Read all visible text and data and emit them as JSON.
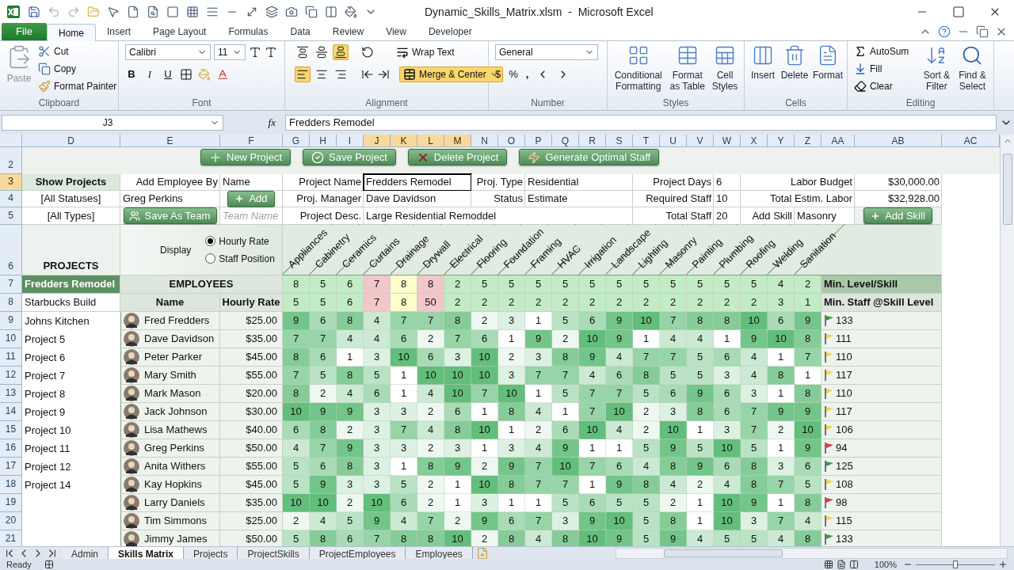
{
  "window": {
    "title": "Dynamic_Skills_Matrix.xlsm  -  Microsoft Excel"
  },
  "ribbon_tabs": [
    {
      "label": "File",
      "kind": "file",
      "selected": false
    },
    {
      "label": "Home",
      "kind": "tab",
      "selected": true
    },
    {
      "label": "Insert",
      "kind": "tab",
      "selected": false
    },
    {
      "label": "Page Layout",
      "kind": "tab",
      "selected": false
    },
    {
      "label": "Formulas",
      "kind": "tab",
      "selected": false
    },
    {
      "label": "Data",
      "kind": "tab",
      "selected": false
    },
    {
      "label": "Review",
      "kind": "tab",
      "selected": false
    },
    {
      "label": "View",
      "kind": "tab",
      "selected": false
    },
    {
      "label": "Developer",
      "kind": "tab",
      "selected": false
    }
  ],
  "ribbon": {
    "clipboard": {
      "label": "Clipboard",
      "paste": "Paste",
      "cut": "Cut",
      "copy": "Copy",
      "format_painter": "Format Painter"
    },
    "font": {
      "label": "Font",
      "family": "Calibri",
      "size": "11",
      "bold": "B",
      "italic": "I",
      "underline": "U"
    },
    "alignment": {
      "label": "Alignment",
      "vertical": [
        {
          "selected": false
        },
        {
          "selected": false
        },
        {
          "selected": true
        }
      ],
      "horizontal": [
        {
          "selected": true
        },
        {
          "selected": false
        },
        {
          "selected": false
        }
      ],
      "wrap_text": "Wrap Text",
      "merge_center": "Merge & Center",
      "merge_on": true
    },
    "number": {
      "label": "Number",
      "format": "General",
      "currency": "$",
      "percent": "%",
      "comma": ","
    },
    "styles": {
      "label": "Styles",
      "buttons": [
        "Conditional Formatting",
        "Format as Table",
        "Cell Styles"
      ]
    },
    "cells": {
      "label": "Cells",
      "buttons": [
        "Insert",
        "Delete",
        "Format"
      ]
    },
    "editing": {
      "label": "Editing",
      "autosum": "AutoSum",
      "fill": "Fill",
      "clear": "Clear",
      "sort_filter": "Sort & Filter",
      "find_select": "Find & Select"
    }
  },
  "formula_bar": {
    "name_box": "J3",
    "fx": "fx",
    "value": "Fredders Remodel"
  },
  "columns": [
    {
      "label": "D",
      "selected": false
    },
    {
      "label": "E",
      "selected": false
    },
    {
      "label": "F",
      "selected": false
    },
    {
      "label": "G",
      "selected": false
    },
    {
      "label": "H",
      "selected": false
    },
    {
      "label": "I",
      "selected": false
    },
    {
      "label": "J",
      "selected": true
    },
    {
      "label": "K",
      "selected": true
    },
    {
      "label": "L",
      "selected": true
    },
    {
      "label": "M",
      "selected": true
    },
    {
      "label": "N",
      "selected": false
    },
    {
      "label": "O",
      "selected": false
    },
    {
      "label": "P",
      "selected": false
    },
    {
      "label": "Q",
      "selected": false
    },
    {
      "label": "R",
      "selected": false
    },
    {
      "label": "S",
      "selected": false
    },
    {
      "label": "T",
      "selected": false
    },
    {
      "label": "U",
      "selected": false
    },
    {
      "label": "V",
      "selected": false
    },
    {
      "label": "W",
      "selected": false
    },
    {
      "label": "X",
      "selected": false
    },
    {
      "label": "Y",
      "selected": false
    },
    {
      "label": "Z",
      "selected": false
    },
    {
      "label": "AA",
      "selected": false
    },
    {
      "label": "AB",
      "selected": false
    },
    {
      "label": "AC",
      "selected": false
    }
  ],
  "row_numbers": [
    {
      "label": "2",
      "selected": false
    },
    {
      "label": "3",
      "selected": true
    },
    {
      "label": "4",
      "selected": false
    },
    {
      "label": "5",
      "selected": false
    },
    {
      "label": "6",
      "selected": false
    },
    {
      "label": "7",
      "selected": false
    },
    {
      "label": "8",
      "selected": false
    },
    {
      "label": "9",
      "selected": false
    },
    {
      "label": "10",
      "selected": false
    },
    {
      "label": "11",
      "selected": false
    },
    {
      "label": "12",
      "selected": false
    },
    {
      "label": "13",
      "selected": false
    },
    {
      "label": "14",
      "selected": false
    },
    {
      "label": "15",
      "selected": false
    },
    {
      "label": "16",
      "selected": false
    },
    {
      "label": "17",
      "selected": false
    },
    {
      "label": "18",
      "selected": false
    },
    {
      "label": "19",
      "selected": false
    },
    {
      "label": "20",
      "selected": false
    },
    {
      "label": "21",
      "selected": false
    }
  ],
  "sheet": {
    "buttons": [
      {
        "label": "New Project",
        "kind": "new"
      },
      {
        "label": "Save Project",
        "kind": "save"
      },
      {
        "label": "Delete Project",
        "kind": "delete"
      },
      {
        "label": "Generate Optimal Staff",
        "kind": "generate"
      }
    ],
    "filter": {
      "title": "Show Projects",
      "status": "[All Statuses]",
      "type": "[All Types]",
      "projects_header": "PROJECTS"
    },
    "add_employee": {
      "label": "Add Employee By",
      "by": "Name",
      "employee": "Greg Perkins",
      "add_button": "Add",
      "team_button": "Save As Team",
      "team_placeholder": "Team Name"
    },
    "project_fields": [
      {
        "label": "Project Name",
        "value": "Fredders Remodel",
        "selected": true
      },
      {
        "label": "Proj. Manager",
        "value": "Dave Davidson",
        "selected": false
      },
      {
        "label": "Project Desc.",
        "value": "Large Residential Remoddel",
        "selected": false
      }
    ],
    "details": [
      {
        "label": "Proj. Type",
        "value": "Residential"
      },
      {
        "label": "Status",
        "value": "Estimate"
      }
    ],
    "staffing": [
      {
        "label": "Project Days",
        "value": "6"
      },
      {
        "label": "Required Staff",
        "value": "10"
      },
      {
        "label": "Total Staff",
        "value": "20"
      }
    ],
    "labor": [
      {
        "label": "Labor Budget",
        "value": "$30,000.00"
      },
      {
        "label": "Total Estim. Labor",
        "value": "$32,928.00"
      }
    ],
    "add_skill": {
      "label": "Add Skill",
      "value": "Masonry",
      "button": "Add Skill"
    },
    "display": {
      "label": "Display",
      "options": [
        {
          "label": "Hourly Rate",
          "selected": true
        },
        {
          "label": "Staff Position",
          "selected": false
        }
      ]
    },
    "employees_header": "EMPLOYEES",
    "name_header": "Name",
    "rate_header": "Hourly Rate",
    "min_level_label": "Min. Level/Skill",
    "min_staff_label": "Min. Staff @Skill Level",
    "skills": [
      {
        "name": "Appliances",
        "min_level": "8",
        "min_staff": "5",
        "color": "#c3ebc5"
      },
      {
        "name": "Cabinetry",
        "min_level": "5",
        "min_staff": "5",
        "color": "#c3ebc5"
      },
      {
        "name": "Ceramics",
        "min_level": "6",
        "min_staff": "6",
        "color": "#c3ebc5"
      },
      {
        "name": "Curtains",
        "min_level": "7",
        "min_staff": "7",
        "color": "#f2c7c9"
      },
      {
        "name": "Drainage",
        "min_level": "8",
        "min_staff": "8",
        "color": "#ffffcc"
      },
      {
        "name": "Drywall",
        "min_level": "8",
        "min_staff": "50",
        "color": "#f2c7c9"
      },
      {
        "name": "Electrical",
        "min_level": "2",
        "min_staff": "2",
        "color": "#c3ebc5"
      },
      {
        "name": "Flooring",
        "min_level": "5",
        "min_staff": "2",
        "color": "#c3ebc5"
      },
      {
        "name": "Foundation",
        "min_level": "5",
        "min_staff": "2",
        "color": "#c3ebc5"
      },
      {
        "name": "Framing",
        "min_level": "5",
        "min_staff": "2",
        "color": "#c3ebc5"
      },
      {
        "name": "HVAC",
        "min_level": "5",
        "min_staff": "2",
        "color": "#c3ebc5"
      },
      {
        "name": "Irrigation",
        "min_level": "5",
        "min_staff": "2",
        "color": "#c3ebc5"
      },
      {
        "name": "Landscape",
        "min_level": "5",
        "min_staff": "2",
        "color": "#c3ebc5"
      },
      {
        "name": "Lighting",
        "min_level": "5",
        "min_staff": "2",
        "color": "#c3ebc5"
      },
      {
        "name": "Masonry",
        "min_level": "5",
        "min_staff": "2",
        "color": "#c3ebc5"
      },
      {
        "name": "Painting",
        "min_level": "5",
        "min_staff": "2",
        "color": "#c3ebc5"
      },
      {
        "name": "Plumbing",
        "min_level": "5",
        "min_staff": "2",
        "color": "#c3ebc5"
      },
      {
        "name": "Roofing",
        "min_level": "5",
        "min_staff": "2",
        "color": "#c3ebc5"
      },
      {
        "name": "Welding",
        "min_level": "4",
        "min_staff": "3",
        "color": "#c3ebc5"
      },
      {
        "name": "Sanitation",
        "min_level": "2",
        "min_staff": "1",
        "color": "#c3ebc5"
      }
    ],
    "projects": [
      {
        "name": "Fredders Remodel",
        "selected": true
      },
      {
        "name": "Starbucks Build",
        "selected": false
      },
      {
        "name": "Johns Kitchen",
        "selected": false
      },
      {
        "name": "Project 5",
        "selected": false
      },
      {
        "name": "Project 6",
        "selected": false
      },
      {
        "name": "Project 7",
        "selected": false
      },
      {
        "name": "Project 8",
        "selected": false
      },
      {
        "name": "Project 9",
        "selected": false
      },
      {
        "name": "Project 10",
        "selected": false
      },
      {
        "name": "Project 11",
        "selected": false
      },
      {
        "name": "Project 12",
        "selected": false
      },
      {
        "name": "Project 14",
        "selected": false
      }
    ],
    "employees": [
      {
        "name": "Fred Fredders",
        "rate": "$25.00",
        "scores": [
          "9",
          "6",
          "8",
          "4",
          "7",
          "7",
          "8",
          "2",
          "3",
          "1",
          "5",
          "6",
          "9",
          "10",
          "7",
          "8",
          "8",
          "10",
          "6",
          "9"
        ],
        "total": "133",
        "color": "#3a9a3f"
      },
      {
        "name": "Dave Davidson",
        "rate": "$35.00",
        "scores": [
          "7",
          "7",
          "4",
          "4",
          "6",
          "2",
          "7",
          "6",
          "1",
          "9",
          "2",
          "10",
          "9",
          "1",
          "4",
          "4",
          "1",
          "9",
          "10",
          "8"
        ],
        "total": "111",
        "color": "#f2d54a"
      },
      {
        "name": "Peter Parker",
        "rate": "$45.00",
        "scores": [
          "8",
          "6",
          "1",
          "3",
          "10",
          "6",
          "3",
          "10",
          "2",
          "3",
          "8",
          "9",
          "4",
          "7",
          "7",
          "5",
          "6",
          "4",
          "1",
          "7"
        ],
        "total": "110",
        "color": "#f2d54a"
      },
      {
        "name": "Mary Smith",
        "rate": "$55.00",
        "scores": [
          "7",
          "5",
          "8",
          "5",
          "1",
          "10",
          "10",
          "10",
          "3",
          "7",
          "7",
          "4",
          "6",
          "8",
          "5",
          "5",
          "3",
          "4",
          "8",
          "1"
        ],
        "total": "117",
        "color": "#f2d54a"
      },
      {
        "name": "Mark Mason",
        "rate": "$20.00",
        "scores": [
          "8",
          "2",
          "4",
          "6",
          "1",
          "4",
          "10",
          "7",
          "10",
          "1",
          "5",
          "7",
          "7",
          "5",
          "6",
          "9",
          "6",
          "3",
          "1",
          "8"
        ],
        "total": "110",
        "color": "#f2d54a"
      },
      {
        "name": "Jack Johnson",
        "rate": "$30.00",
        "scores": [
          "10",
          "9",
          "9",
          "3",
          "3",
          "2",
          "6",
          "1",
          "8",
          "4",
          "1",
          "7",
          "10",
          "2",
          "3",
          "8",
          "6",
          "7",
          "9",
          "9"
        ],
        "total": "117",
        "color": "#f2d54a"
      },
      {
        "name": "Lisa Mathews",
        "rate": "$40.00",
        "scores": [
          "6",
          "8",
          "2",
          "3",
          "7",
          "4",
          "8",
          "10",
          "1",
          "2",
          "6",
          "10",
          "4",
          "2",
          "10",
          "1",
          "3",
          "7",
          "2",
          "10"
        ],
        "total": "106",
        "color": "#f2d54a"
      },
      {
        "name": "Greg Perkins",
        "rate": "$50.00",
        "scores": [
          "4",
          "7",
          "9",
          "3",
          "3",
          "2",
          "3",
          "1",
          "3",
          "4",
          "9",
          "1",
          "1",
          "5",
          "9",
          "5",
          "10",
          "5",
          "1",
          "9"
        ],
        "total": "94",
        "color": "#e0393e"
      },
      {
        "name": "Anita Withers",
        "rate": "$55.00",
        "scores": [
          "5",
          "6",
          "8",
          "3",
          "1",
          "8",
          "9",
          "2",
          "9",
          "7",
          "10",
          "7",
          "6",
          "4",
          "8",
          "9",
          "6",
          "8",
          "3",
          "6"
        ],
        "total": "125",
        "color": "#3a9a3f"
      },
      {
        "name": "Kay Hopkins",
        "rate": "$45.00",
        "scores": [
          "5",
          "9",
          "3",
          "3",
          "5",
          "2",
          "1",
          "10",
          "8",
          "7",
          "7",
          "1",
          "9",
          "8",
          "4",
          "2",
          "4",
          "8",
          "7",
          "5"
        ],
        "total": "108",
        "color": "#f2d54a"
      },
      {
        "name": "Larry Daniels",
        "rate": "$35.00",
        "scores": [
          "10",
          "10",
          "2",
          "10",
          "6",
          "2",
          "1",
          "3",
          "1",
          "1",
          "5",
          "6",
          "5",
          "5",
          "2",
          "1",
          "10",
          "9",
          "1",
          "8"
        ],
        "total": "98",
        "color": "#e0393e"
      },
      {
        "name": "Tim Simmons",
        "rate": "$25.00",
        "scores": [
          "2",
          "4",
          "5",
          "9",
          "4",
          "7",
          "2",
          "9",
          "6",
          "7",
          "3",
          "9",
          "10",
          "5",
          "8",
          "1",
          "10",
          "3",
          "7",
          "4"
        ],
        "total": "115",
        "color": "#f2d54a"
      },
      {
        "name": "Jimmy James",
        "rate": "$50.00",
        "scores": [
          "5",
          "8",
          "6",
          "7",
          "8",
          "8",
          "10",
          "2",
          "8",
          "4",
          "8",
          "10",
          "9",
          "5",
          "9",
          "4",
          "5",
          "5",
          "4",
          "8"
        ],
        "total": "133",
        "color": "#3a9a3f"
      }
    ]
  },
  "sheet_tabs": [
    {
      "label": "Admin",
      "selected": false
    },
    {
      "label": "Skills Matrix",
      "selected": true
    },
    {
      "label": "Projects",
      "selected": false
    },
    {
      "label": "ProjectSkills",
      "selected": false
    },
    {
      "label": "ProjectEmployees",
      "selected": false
    },
    {
      "label": "Employees",
      "selected": false
    }
  ],
  "status_bar": {
    "mode": "Ready",
    "zoom": "100%",
    "zoom_slider": {
      "level": 0.5
    }
  }
}
